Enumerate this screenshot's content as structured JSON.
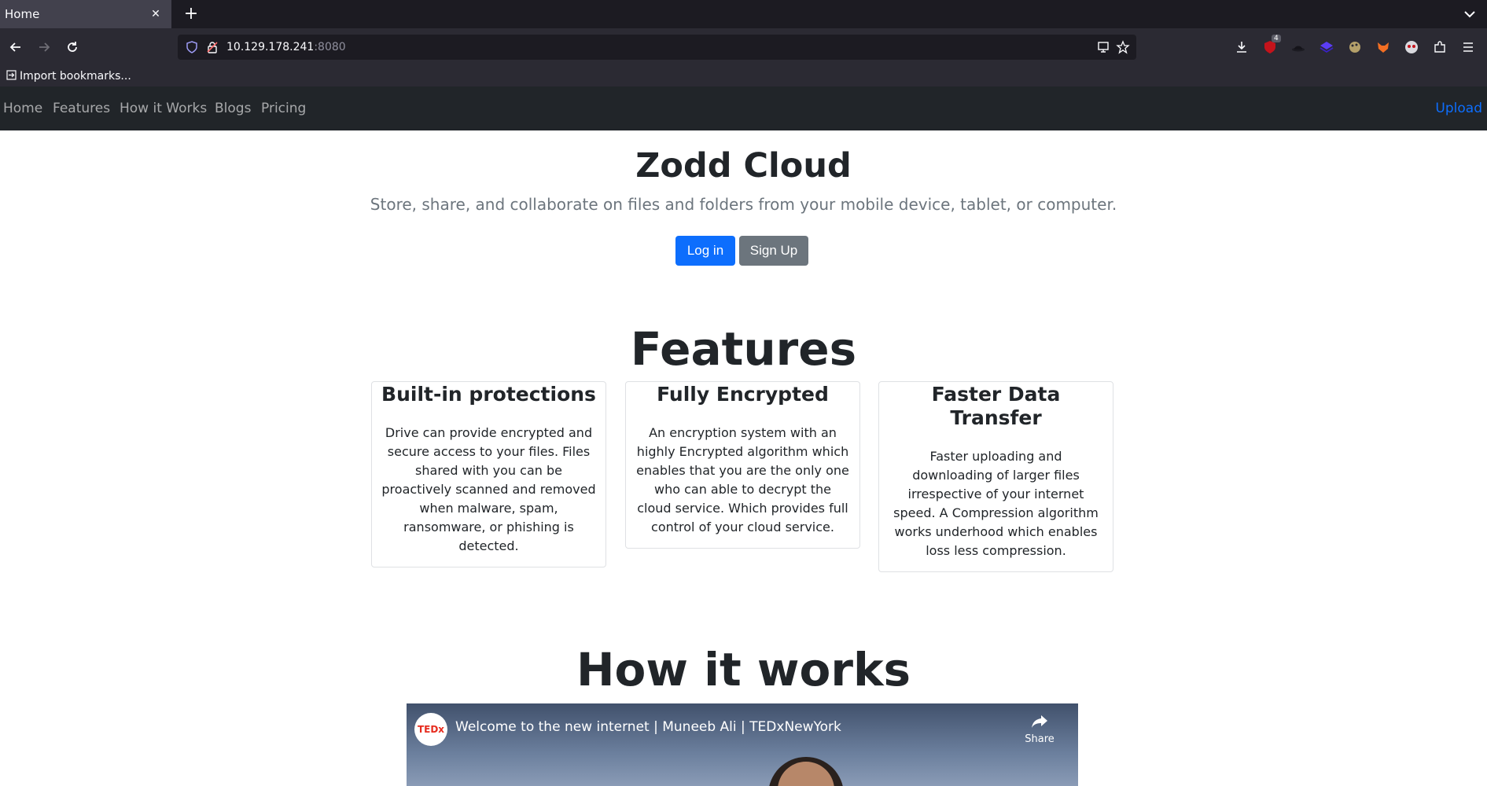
{
  "browser": {
    "tab_title": "Home",
    "url_host": "10.129.178.241",
    "url_port": ":8080",
    "bookmark_label": "Import bookmarks...",
    "extension_badge": "4"
  },
  "site": {
    "nav": [
      "Home",
      "Features",
      "How it Works",
      "Blogs",
      "Pricing"
    ],
    "upload_label": "Upload",
    "brand_color": "#0d6efd"
  },
  "hero": {
    "title": "Zodd Cloud",
    "subtitle": "Store, share, and collaborate on files and folders from your mobile device, tablet, or computer.",
    "login_label": "Log in",
    "signup_label": "Sign Up"
  },
  "features": {
    "title": "Features",
    "cards": [
      {
        "title": "Built-in protections",
        "text": "Drive can provide encrypted and secure access to your files. Files shared with you can be proactively scanned and removed when malware, spam, ransomware, or phishing is detected."
      },
      {
        "title": "Fully Encrypted",
        "text": "An encryption system with an highly Encrypted algorithm which enables that you are the only one who can able to decrypt the cloud service. Which provides full control of your cloud service."
      },
      {
        "title": "Faster Data Transfer",
        "text": "Faster uploading and downloading of larger files irrespective of your internet speed. A Compression algorithm works underhood which enables loss less compression."
      }
    ]
  },
  "how": {
    "title": "How it works",
    "video_logo": "TEDx",
    "video_title": "Welcome to the new internet | Muneeb Ali | TEDxNewYork",
    "share_label": "Share"
  }
}
